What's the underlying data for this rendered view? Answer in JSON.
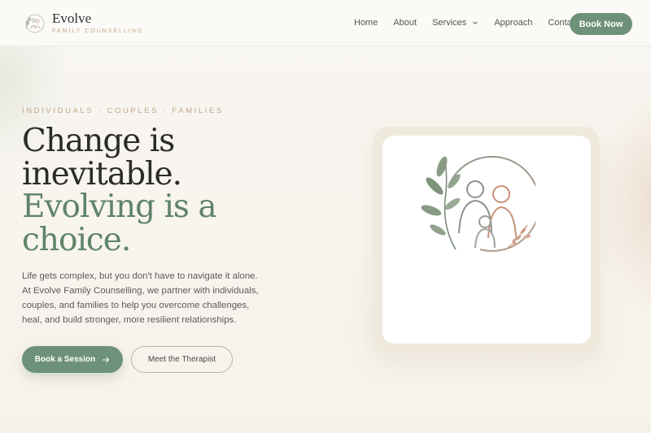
{
  "brand": {
    "name": "Evolve",
    "tagline": "FAMILY COUNSELLING",
    "icon": "leaf-family-logo-icon"
  },
  "nav": {
    "items": [
      {
        "label": "Home"
      },
      {
        "label": "About"
      },
      {
        "label": "Services",
        "has_dropdown": true
      },
      {
        "label": "Approach"
      },
      {
        "label": "Contact"
      }
    ],
    "cta_label": "Book Now"
  },
  "hero": {
    "eyebrow": "INDIVIDUALS · COUPLES · FAMILIES",
    "headline_lines": [
      "Change is",
      "inevitable.",
      "Evolving is a",
      "choice."
    ],
    "lead": "Life gets complex, but you don't have to navigate it alone. At Evolve Family Counselling, we partner with individuals, couples, and families to help you overcome challenges, heal, and build stronger, more resilient relationships.",
    "primary_button": "Book a Session",
    "secondary_button": "Meet the Therapist",
    "illustration": "family-circle-leaves-icon"
  },
  "colors": {
    "accent_green": "#6e9179",
    "headline_green": "#5f8468",
    "eyebrow_tan": "#c4a586",
    "background": "#f8f4ee"
  }
}
